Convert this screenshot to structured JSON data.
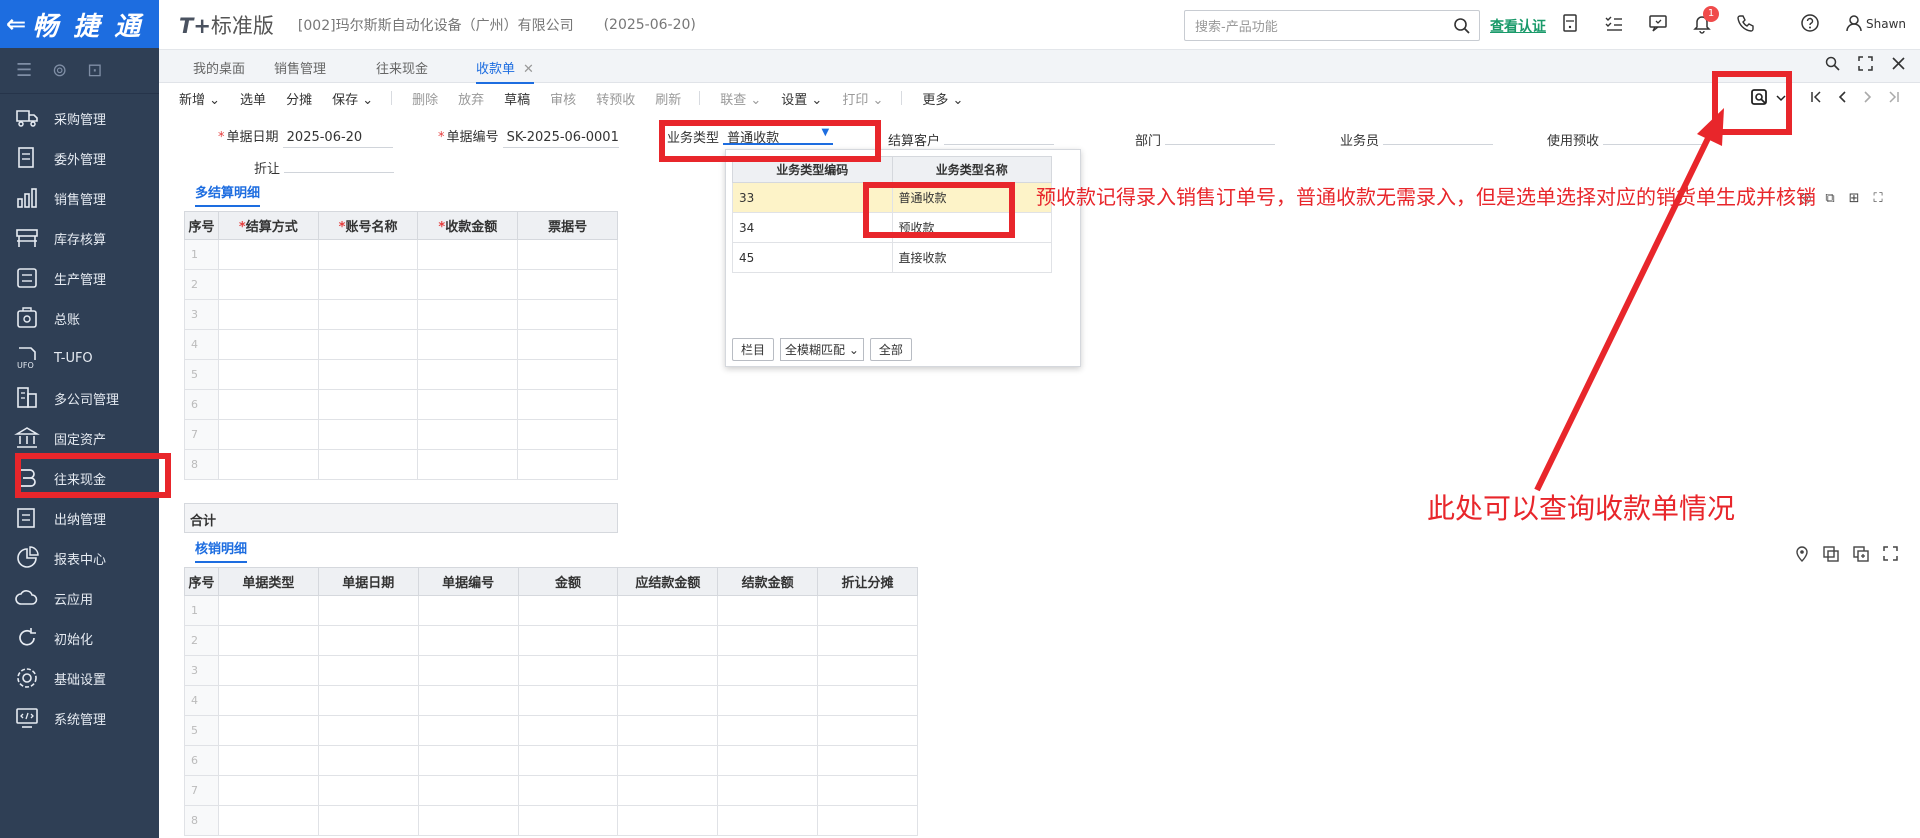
{
  "app": {
    "logo_text": "畅 捷 通",
    "brand": "T+",
    "brand_suffix": "标准版",
    "company": "[002]玛尔斯斯自动化设备（广州）有限公司",
    "date": "(2025-06-20)",
    "search_placeholder": "搜索-产品功能",
    "verify_link": "查看认证",
    "notification_count": "1",
    "user_name": "Shawn"
  },
  "sidebar": {
    "items": [
      {
        "label": "采购管理",
        "icon": "truck-icon"
      },
      {
        "label": "委外管理",
        "icon": "document-icon"
      },
      {
        "label": "销售管理",
        "icon": "chart-icon"
      },
      {
        "label": "库存核算",
        "icon": "shelf-icon"
      },
      {
        "label": "生产管理",
        "icon": "factory-icon"
      },
      {
        "label": "总账",
        "icon": "ledger-icon"
      },
      {
        "label": "T-UFO",
        "icon": "ufo-icon"
      },
      {
        "label": "多公司管理",
        "icon": "building-icon"
      },
      {
        "label": "固定资产",
        "icon": "bank-icon"
      },
      {
        "label": "往来现金",
        "icon": "cash-icon"
      },
      {
        "label": "出纳管理",
        "icon": "cashier-icon"
      },
      {
        "label": "报表中心",
        "icon": "pie-icon"
      },
      {
        "label": "云应用",
        "icon": "cloud-icon"
      },
      {
        "label": "初始化",
        "icon": "refresh-icon"
      },
      {
        "label": "基础设置",
        "icon": "settings-icon"
      },
      {
        "label": "系统管理",
        "icon": "monitor-icon"
      }
    ]
  },
  "tabs": [
    {
      "label": "我的桌面"
    },
    {
      "label": "销售管理"
    },
    {
      "label": "往来现金"
    },
    {
      "label": "收款单",
      "active": true
    }
  ],
  "toolbar": {
    "items": [
      {
        "label": "新增",
        "dropdown": true,
        "disabled": false
      },
      {
        "label": "选单",
        "disabled": false
      },
      {
        "label": "分摊",
        "disabled": false
      },
      {
        "label": "保存",
        "dropdown": true,
        "disabled": false
      },
      {
        "label": "删除",
        "disabled": true
      },
      {
        "label": "放弃",
        "disabled": true
      },
      {
        "label": "草稿",
        "disabled": false
      },
      {
        "label": "审核",
        "disabled": true
      },
      {
        "label": "转预收",
        "disabled": true
      },
      {
        "label": "刷新",
        "disabled": true
      },
      {
        "label": "联查",
        "dropdown": true,
        "disabled": true
      },
      {
        "label": "设置",
        "dropdown": true,
        "disabled": false
      },
      {
        "label": "打印",
        "dropdown": true,
        "disabled": true
      },
      {
        "label": "更多",
        "dropdown": true,
        "disabled": false
      }
    ]
  },
  "form": {
    "doc_date_label": "单据日期",
    "doc_date_value": "2025-06-20",
    "doc_no_label": "单据编号",
    "doc_no_value": "SK-2025-06-0001",
    "biz_type_label": "业务类型",
    "biz_type_value": "普通收款",
    "customer_label": "结算客户",
    "dept_label": "部门",
    "salesman_label": "业务员",
    "use_prepay_label": "使用预收",
    "discount_label": "折让"
  },
  "settlement": {
    "title": "多结算明细",
    "columns": [
      "序号",
      "结算方式",
      "账号名称",
      "收款金额",
      "票据号"
    ],
    "required": [
      false,
      true,
      true,
      true,
      false
    ],
    "rows": [
      "1",
      "2",
      "3",
      "4",
      "5",
      "6",
      "7",
      "8"
    ],
    "total_label": "合计"
  },
  "writeoff": {
    "title": "核销明细",
    "columns": [
      "序号",
      "单据类型",
      "单据日期",
      "单据编号",
      "金额",
      "应结款金额",
      "结款金额",
      "折让分摊"
    ],
    "rows": [
      "1",
      "2",
      "3",
      "4",
      "5",
      "6",
      "7",
      "8"
    ]
  },
  "dropdown": {
    "columns": [
      "业务类型编码",
      "业务类型名称"
    ],
    "rows": [
      {
        "code": "33",
        "name": "普通收款"
      },
      {
        "code": "34",
        "name": "预收款"
      },
      {
        "code": "45",
        "name": "直接收款"
      }
    ],
    "column_button": "栏目",
    "match_option": "全模糊匹配",
    "all_button": "全部"
  },
  "annotations": {
    "note1": "预收款记得录入销售订单号，普通收款无需录入，但是选单选择对应的销货单生成并核销",
    "note2": "此处可以查询收款单情况"
  },
  "colors": {
    "sidebar_bg": "#2f3f55",
    "logo_bg": "#1d6de0",
    "accent": "#1d6de0",
    "annotation_red": "#e8262b"
  }
}
